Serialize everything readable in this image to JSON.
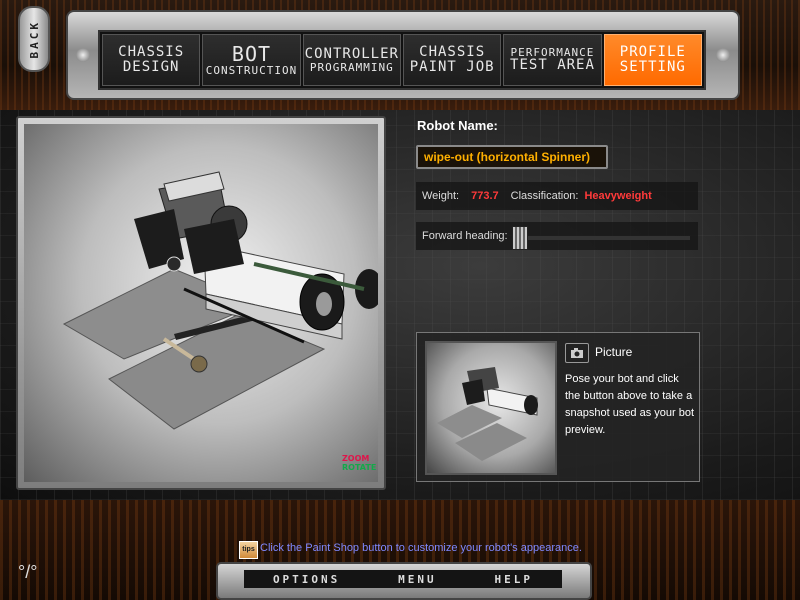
{
  "back_label": "BACK",
  "tabs": [
    {
      "l1": "CHASSIS",
      "l2": "DESIGN",
      "active": false
    },
    {
      "l1": "BOT",
      "l2": "CONSTRUCTION",
      "active": false
    },
    {
      "l1": "CONTROLLER",
      "l2": "PROGRAMMING",
      "active": false
    },
    {
      "l1": "CHASSIS",
      "l2": "PAINT JOB",
      "active": false
    },
    {
      "l1": "PERFORMANCE",
      "l2": "TEST AREA",
      "active": false
    },
    {
      "l1": "PROFILE",
      "l2": "SETTING",
      "active": true
    }
  ],
  "viewport": {
    "zoom_label": "ZOOM",
    "rotate_label": "ROTATE"
  },
  "robot": {
    "name_label": "Robot Name:",
    "name_value": "wipe-out (horizontal Spinner)",
    "weight_label": "Weight:",
    "weight_value": "773.7",
    "class_label": "Classification:",
    "class_value": "Heavyweight",
    "heading_label": "Forward heading:"
  },
  "picture": {
    "title": "Picture",
    "description": "Pose your bot and click the button above to take a snapshot used as your bot preview."
  },
  "tip": {
    "icon_text": "tips",
    "text": "Click the Paint Shop button to customize your robot's appearance."
  },
  "bottom_nav": {
    "options": "OPTIONS",
    "menu": "MENU",
    "help": "HELP"
  },
  "colors": {
    "accent": "#ff6a00",
    "name_text": "#ffb000",
    "stat_value": "#ff3a3a",
    "tip_text": "#7f88ff"
  }
}
